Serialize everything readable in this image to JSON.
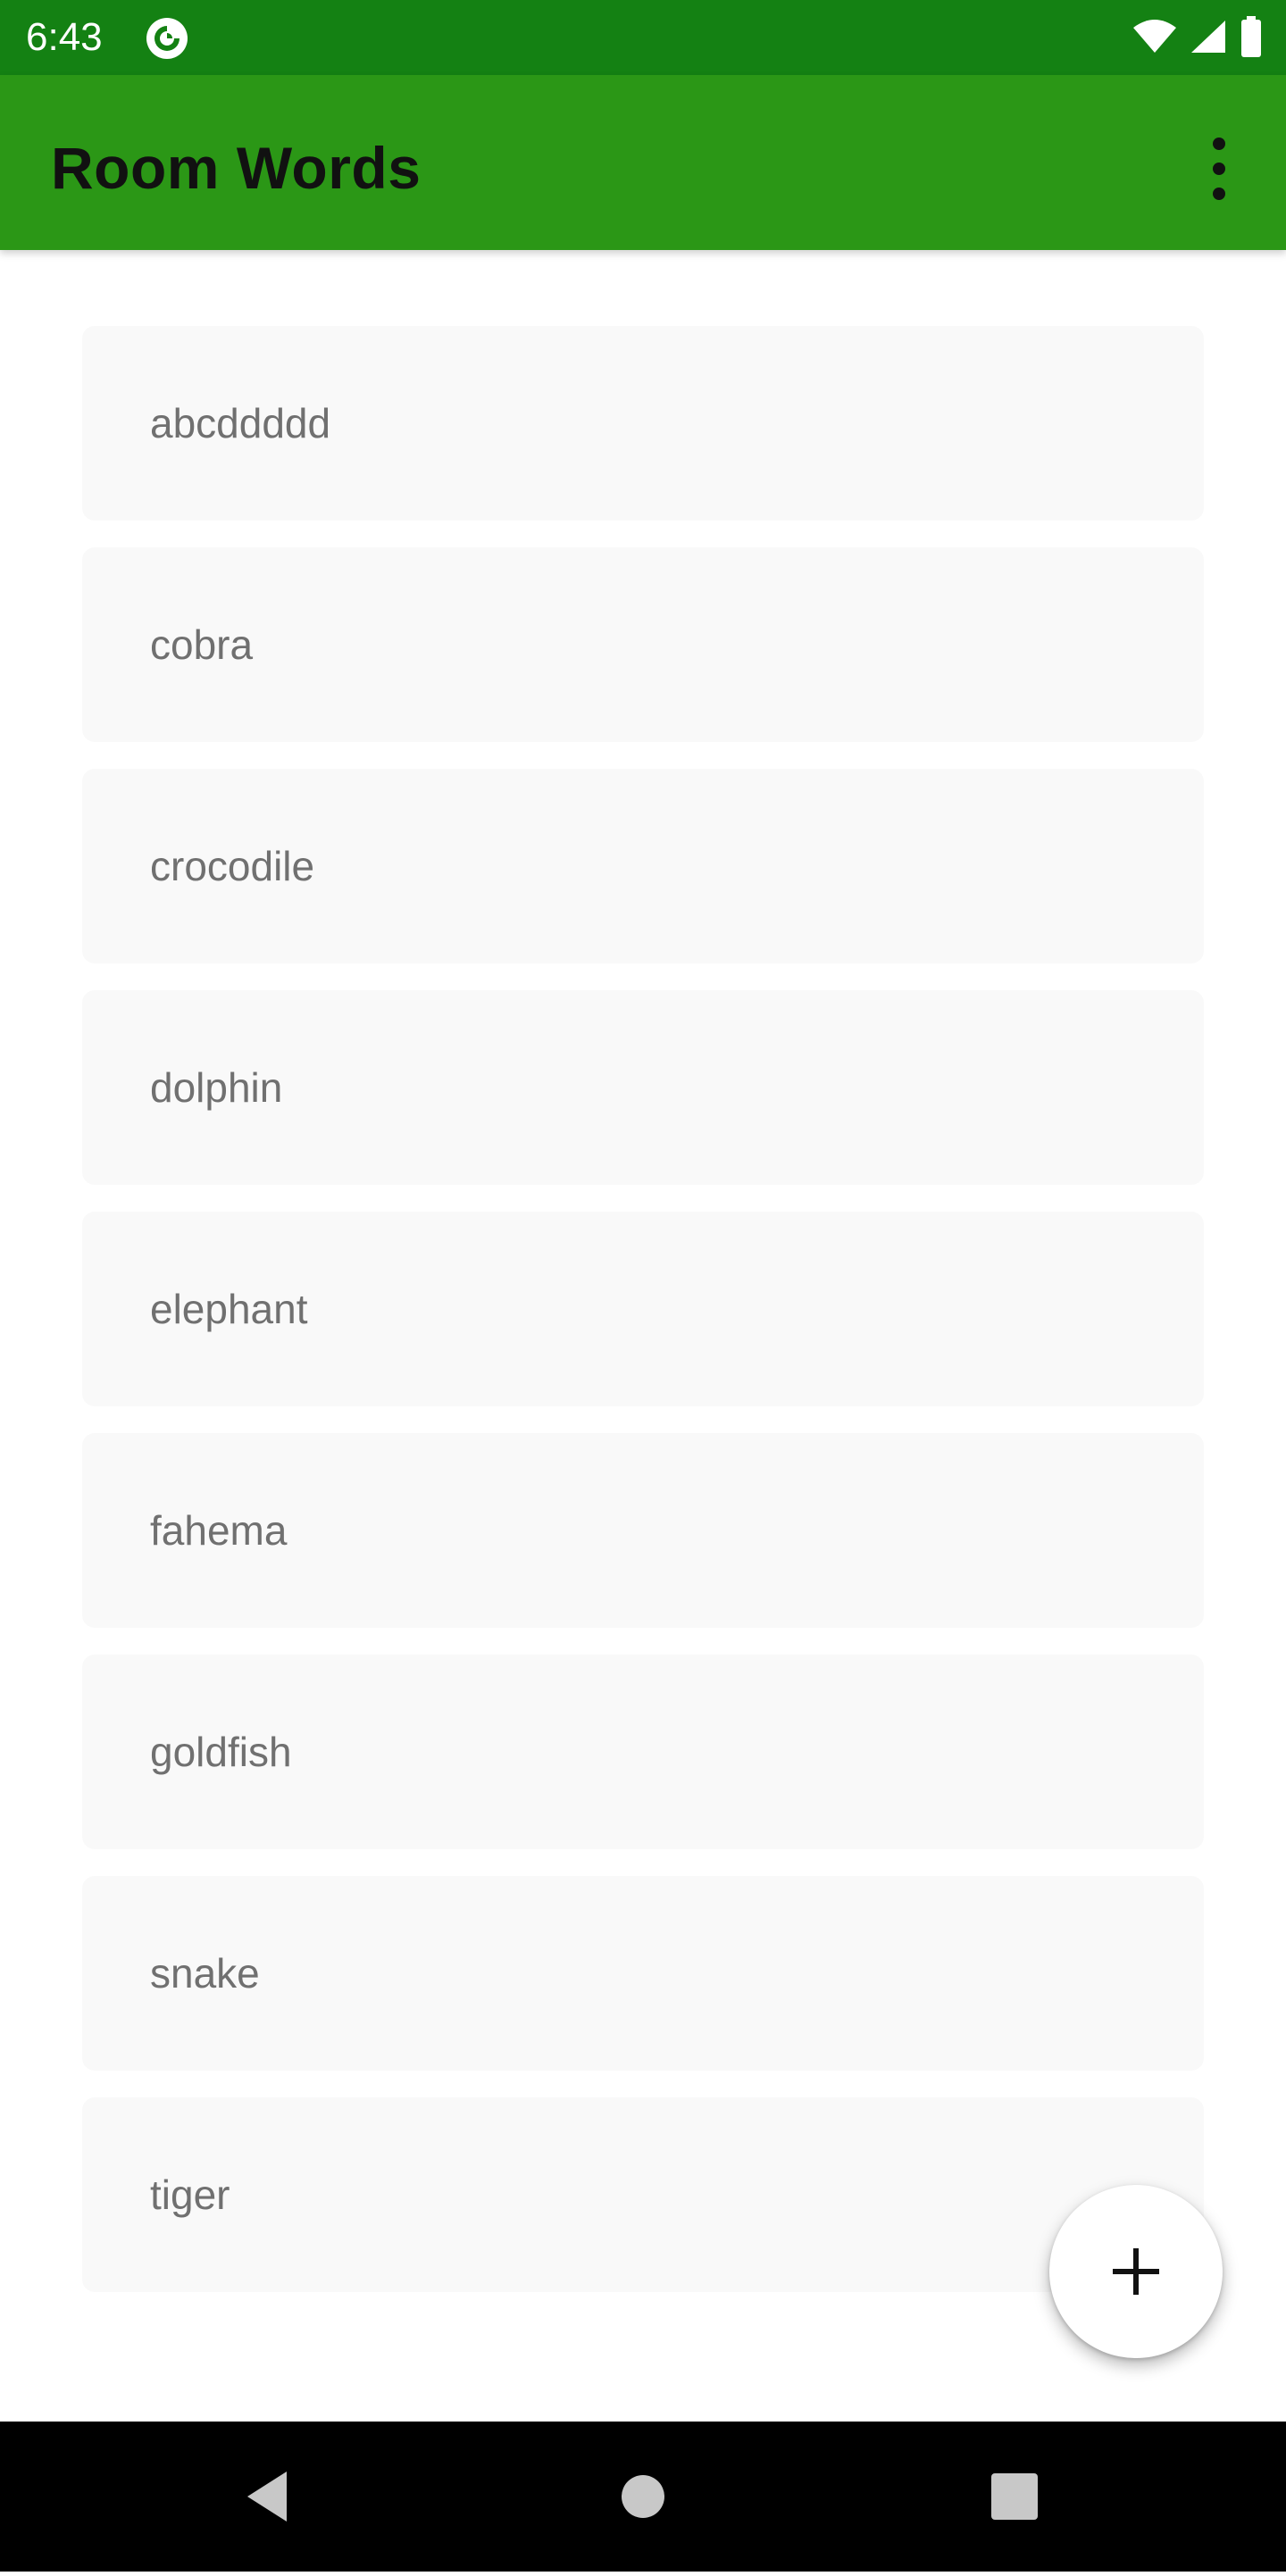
{
  "status_bar": {
    "time": "6:43",
    "app_icon": "pocket-casts-icon",
    "wifi_icon": "wifi-icon",
    "signal_icon": "cell-signal-icon",
    "battery_icon": "battery-icon"
  },
  "app_bar": {
    "title": "Room Words",
    "menu_icon": "more-vert-icon",
    "color": "#2b9716",
    "status_color": "#148113"
  },
  "words": [
    "abcddddd",
    "cobra",
    "crocodile",
    "dolphin",
    "elephant",
    "fahema",
    "goldfish",
    "snake",
    "tiger"
  ],
  "fab": {
    "icon": "add-icon"
  },
  "nav_bar": {
    "back_icon": "back-triangle-icon",
    "home_icon": "home-circle-icon",
    "recents_icon": "recents-square-icon"
  }
}
